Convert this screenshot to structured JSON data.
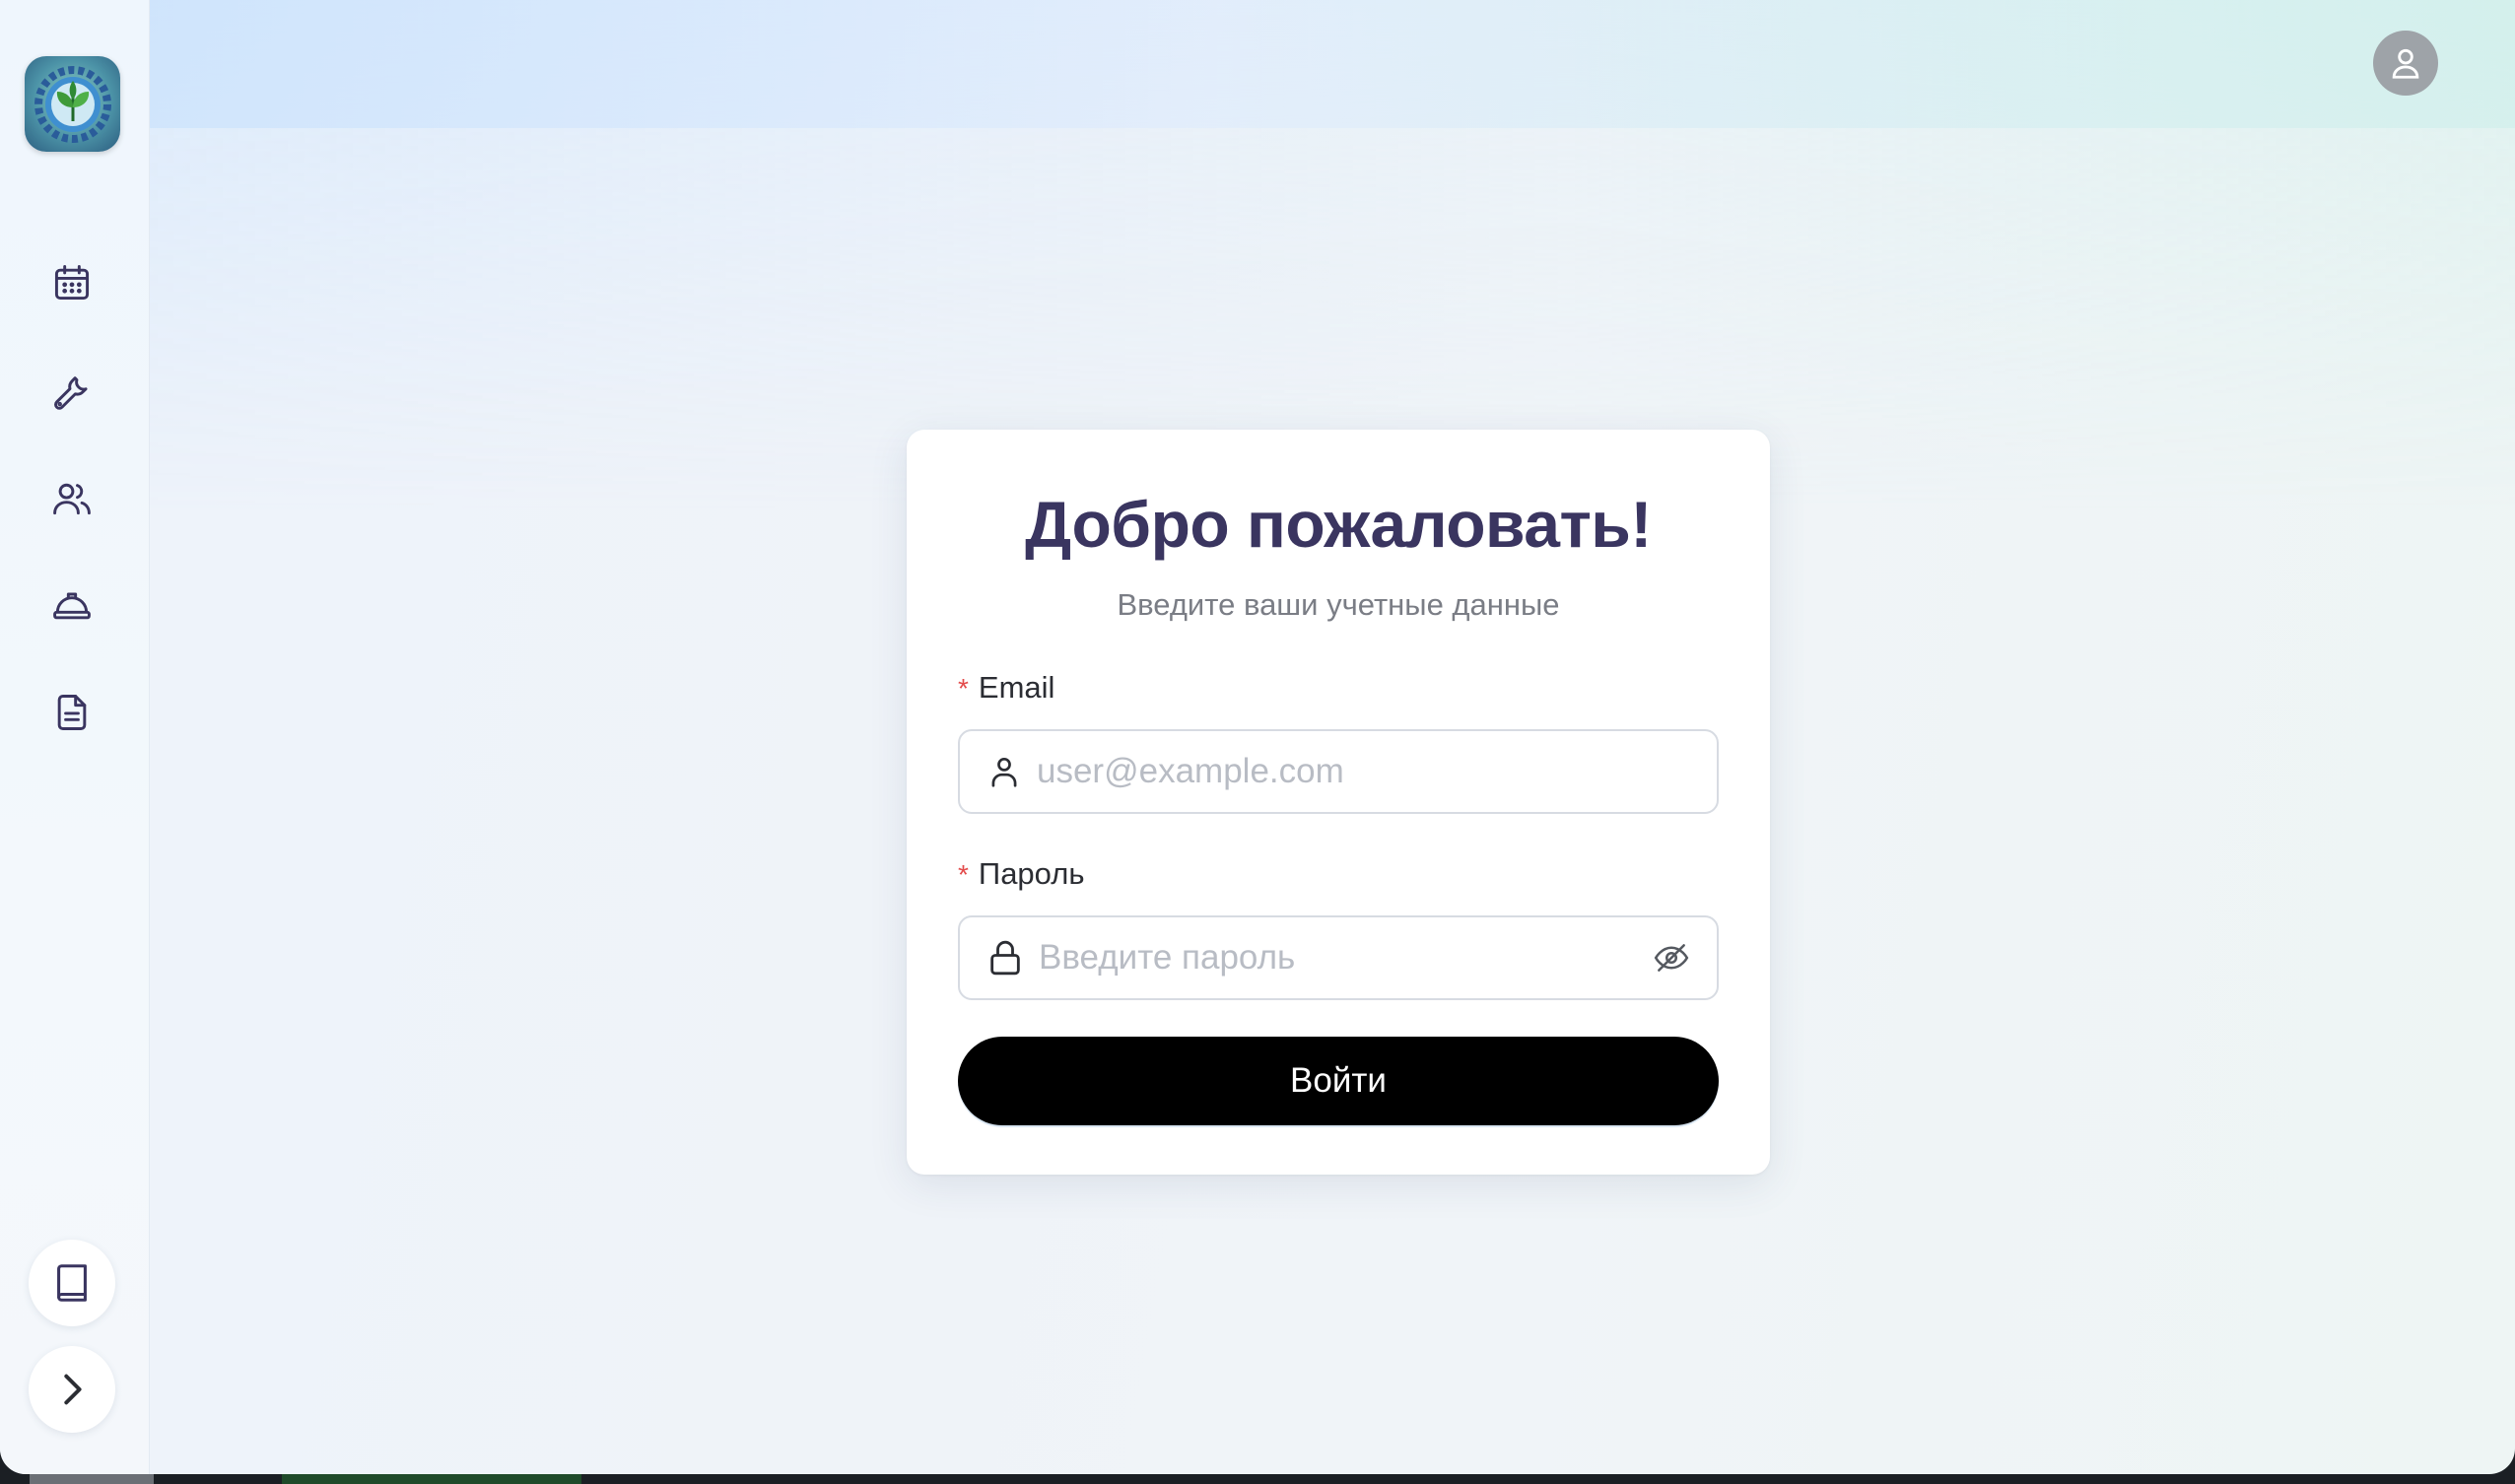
{
  "app": {
    "logo_icon": "leaf-gear-logo"
  },
  "sidebar": {
    "items": [
      {
        "name": "calendar",
        "icon": "calendar-icon"
      },
      {
        "name": "tools",
        "icon": "wrench-icon"
      },
      {
        "name": "users",
        "icon": "users-icon"
      },
      {
        "name": "safety",
        "icon": "hard-hat-icon"
      },
      {
        "name": "documents",
        "icon": "document-icon"
      }
    ],
    "bottom": [
      {
        "name": "docs",
        "icon": "book-icon"
      },
      {
        "name": "expand",
        "icon": "chevron-right-icon"
      }
    ]
  },
  "header": {
    "avatar_icon": "user-avatar-icon"
  },
  "login": {
    "title": "Добро пожаловать!",
    "subtitle": "Введите ваши учетные данные",
    "email_label": "Email",
    "email_placeholder": "user@example.com",
    "email_value": "",
    "password_label": "Пароль",
    "password_placeholder": "Введите пароль",
    "password_value": "",
    "required_mark": "*",
    "submit_label": "Войти"
  },
  "colors": {
    "title": "#3a3560",
    "button_bg": "#000000",
    "required": "#e34c4c",
    "avatar_bg": "#9ea3a8"
  }
}
